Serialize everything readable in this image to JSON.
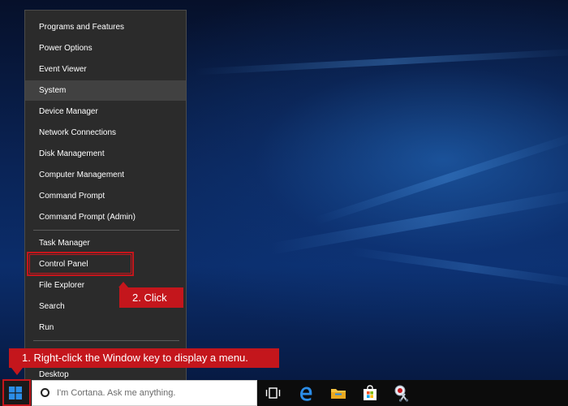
{
  "start_menu": {
    "items_group1": [
      {
        "label": "Programs and Features"
      },
      {
        "label": "Power Options"
      },
      {
        "label": "Event Viewer"
      },
      {
        "label": "System"
      },
      {
        "label": "Device Manager"
      },
      {
        "label": "Network Connections"
      },
      {
        "label": "Disk Management"
      },
      {
        "label": "Computer Management"
      },
      {
        "label": "Command Prompt"
      },
      {
        "label": "Command Prompt (Admin)"
      }
    ],
    "items_group2": [
      {
        "label": "Task Manager"
      },
      {
        "label": "Control Panel"
      },
      {
        "label": "File Explorer"
      },
      {
        "label": "Search"
      },
      {
        "label": "Run"
      }
    ],
    "items_group3": [
      {
        "label": "Desktop"
      }
    ],
    "highlighted_item": "System"
  },
  "annotations": {
    "step1": "1. Right-click the Window key to display a menu.",
    "step2": "2. Click",
    "color": "#c4161c"
  },
  "taskbar": {
    "search_placeholder": "I'm Cortana. Ask me anything.",
    "icons": [
      "start-windows-icon",
      "task-view-icon",
      "edge-browser-icon",
      "file-explorer-icon",
      "store-icon",
      "snipping-tool-icon"
    ]
  },
  "colors": {
    "menu_bg": "#2b2b2b",
    "menu_highlight": "#414141",
    "accent_blue": "#0078d7",
    "taskbar_bg": "#0c0c0c"
  }
}
